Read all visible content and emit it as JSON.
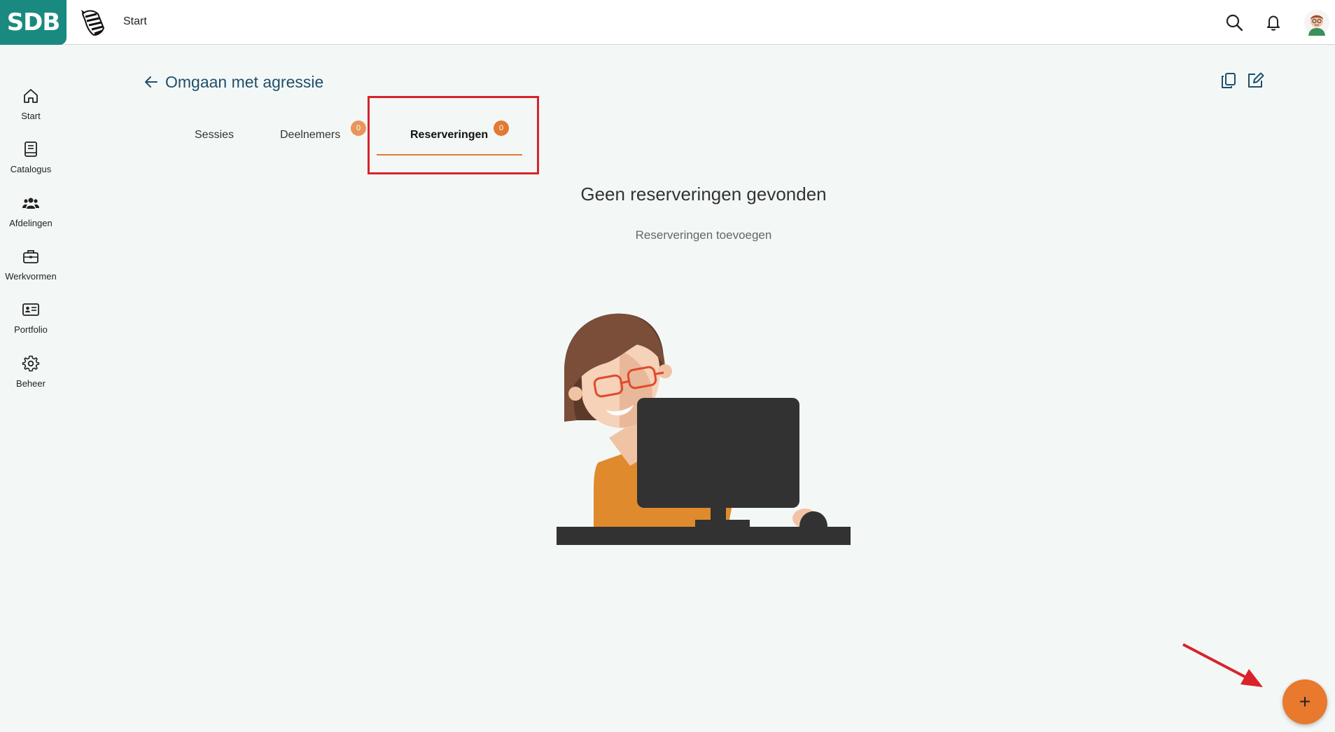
{
  "header": {
    "brand": "SDB",
    "title": "Start"
  },
  "sidebar": {
    "items": [
      {
        "label": "Start",
        "icon": "home-icon"
      },
      {
        "label": "Catalogus",
        "icon": "book-icon"
      },
      {
        "label": "Afdelingen",
        "icon": "people-icon"
      },
      {
        "label": "Werkvormen",
        "icon": "briefcase-icon"
      },
      {
        "label": "Portfolio",
        "icon": "id-card-icon"
      },
      {
        "label": "Beheer",
        "icon": "gear-icon"
      }
    ]
  },
  "page": {
    "title": "Omgaan met agressie"
  },
  "tabs": [
    {
      "label": "Sessies"
    },
    {
      "label": "Deelnemers",
      "count": "0"
    },
    {
      "label": "Reserveringen",
      "count": "0",
      "active": true
    }
  ],
  "empty_state": {
    "title": "Geen reserveringen gevonden",
    "subtitle": "Reserveringen toevoegen"
  },
  "fab": {
    "label": "+"
  },
  "colors": {
    "brand": "#1a8a80",
    "accent": "#e07a35",
    "highlight": "#d9232b"
  }
}
